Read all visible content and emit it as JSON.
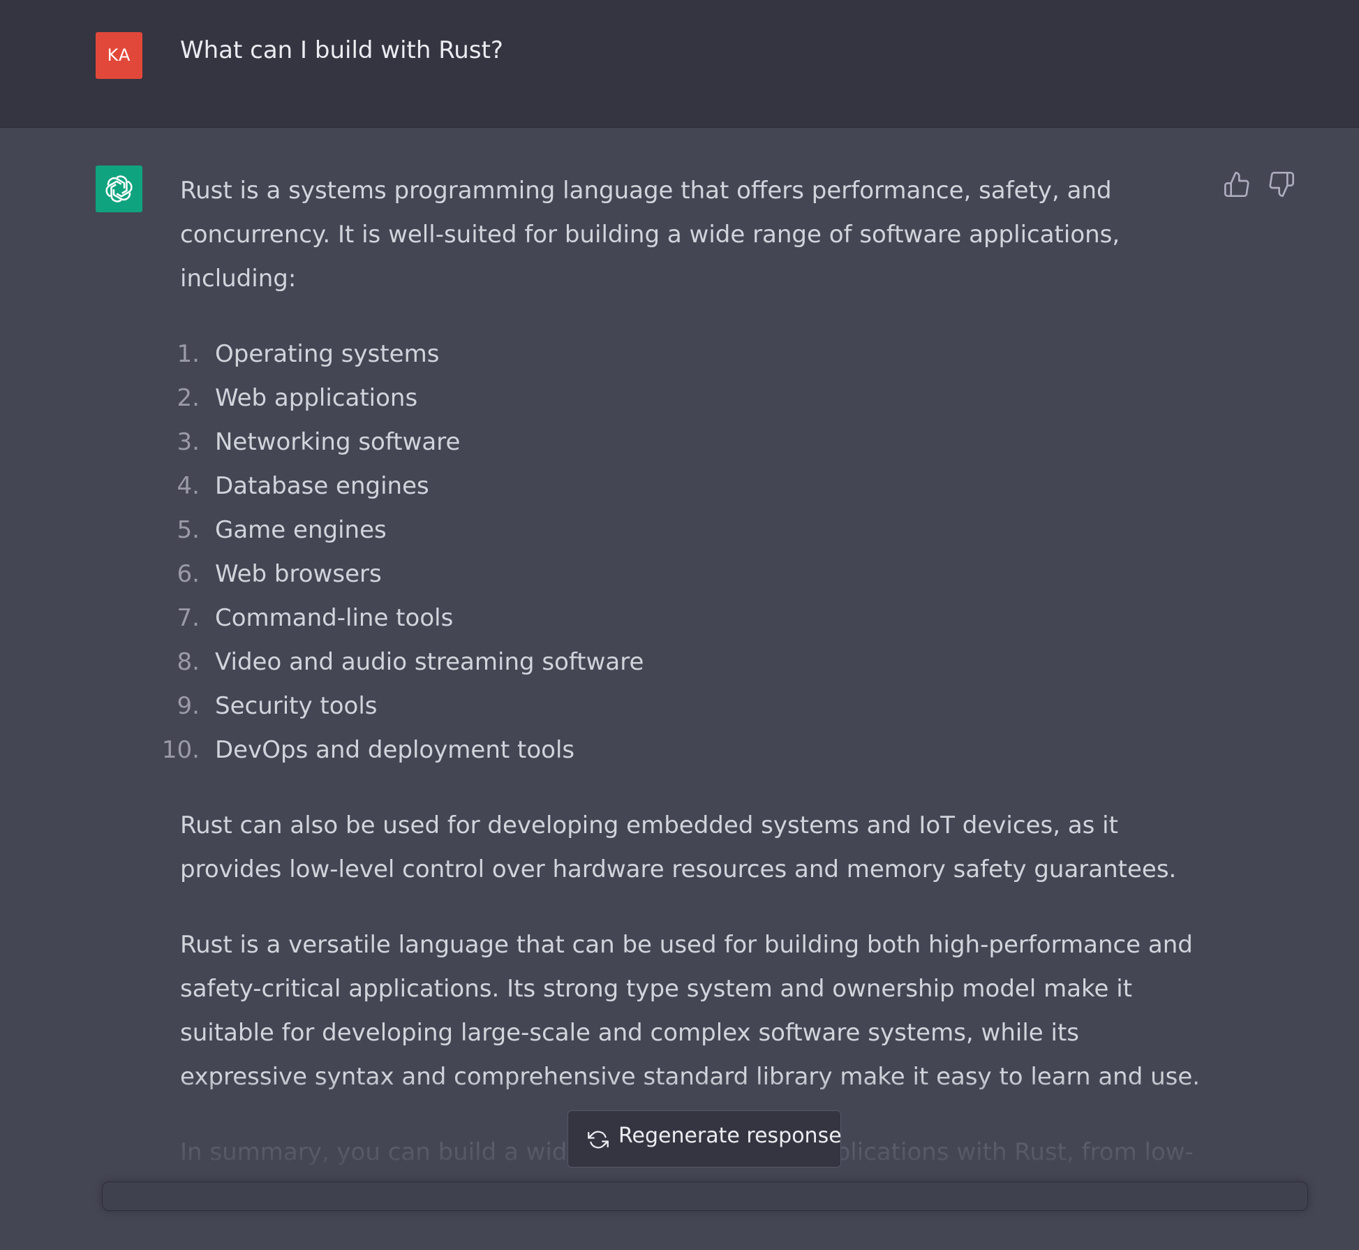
{
  "user_message": {
    "avatar_initials": "KA",
    "text": "What can I build with Rust?"
  },
  "assistant_message": {
    "avatar_icon": "openai-logo-icon",
    "intro": "Rust is a systems programming language that offers performance, safety, and concurrency. It is well-suited for building a wide range of software applications, including:",
    "list": [
      {
        "num": "1.",
        "text": "Operating systems"
      },
      {
        "num": "2.",
        "text": "Web applications"
      },
      {
        "num": "3.",
        "text": "Networking software"
      },
      {
        "num": "4.",
        "text": "Database engines"
      },
      {
        "num": "5.",
        "text": "Game engines"
      },
      {
        "num": "6.",
        "text": "Web browsers"
      },
      {
        "num": "7.",
        "text": "Command-line tools"
      },
      {
        "num": "8.",
        "text": "Video and audio streaming software"
      },
      {
        "num": "9.",
        "text": "Security tools"
      },
      {
        "num": "10.",
        "text": "DevOps and deployment tools"
      }
    ],
    "paragraph_2": "Rust can also be used for developing embedded systems and IoT devices, as it provides low-level control over hardware resources and memory safety guarantees.",
    "paragraph_3": "Rust is a versatile language that can be used for building both high-performance and safety-critical applications. Its strong type system and ownership model make it suitable for developing large-scale and complex software systems, while its expressive syntax and comprehensive standard library make it easy to learn and use.",
    "paragraph_4": "In summary, you can build a wide range of software applications with Rust, from low-level system software to high-level web applications."
  },
  "feedback": {
    "thumbs_up_icon": "thumbs-up-icon",
    "thumbs_down_icon": "thumbs-down-icon"
  },
  "regenerate": {
    "label": "Regenerate response",
    "icon": "refresh-icon"
  },
  "colors": {
    "user_bg": "#343541",
    "assistant_bg": "#444654",
    "user_avatar": "#e2483a",
    "bot_avatar": "#10a37f",
    "text": "#d1d5db"
  }
}
